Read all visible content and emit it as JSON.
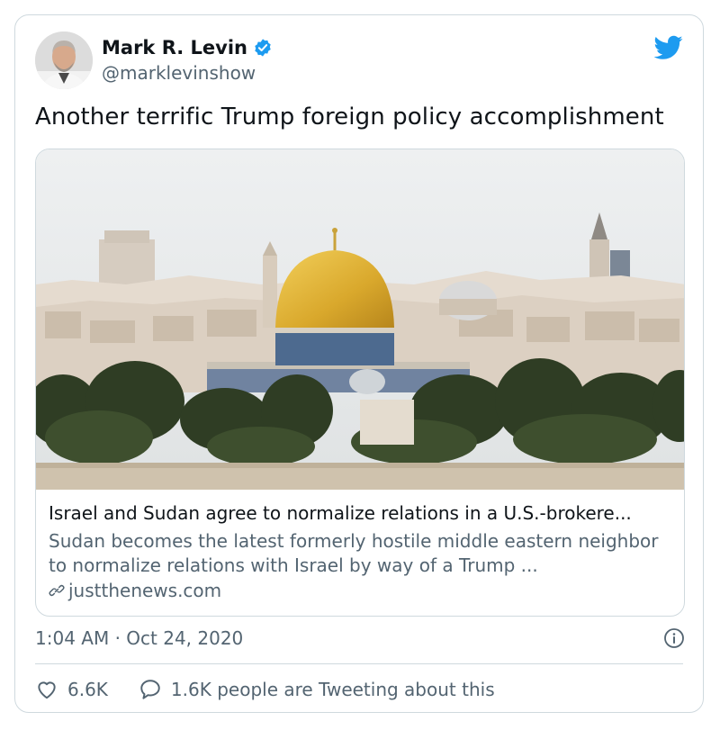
{
  "author": {
    "name": "Mark R. Levin",
    "handle": "@marklevinshow",
    "verified": true
  },
  "tweet": {
    "text": "Another terrific Trump foreign policy accomplishment",
    "timestamp": "1:04 AM · Oct 24, 2020"
  },
  "link_card": {
    "title": "Israel and Sudan agree to normalize relations in a U.S.-brokere...",
    "description": "Sudan becomes the latest formerly hostile middle eastern neighbor to normalize relations with Israel by way of a Trump ...",
    "domain": "justthenews.com",
    "image_subject": "Jerusalem skyline with Dome of the Rock"
  },
  "actions": {
    "likes": "6.6K",
    "tweeting": "1.6K people are Tweeting about this"
  },
  "icons": {
    "brand": "twitter-bird-icon",
    "verified": "verified-badge-icon",
    "info": "info-icon",
    "like": "heart-icon",
    "reply": "speech-bubble-icon",
    "link": "link-icon"
  },
  "colors": {
    "brand_blue": "#1d9bf0",
    "text_primary": "#0f1419",
    "text_secondary": "#536471",
    "border": "#cfd9de"
  }
}
